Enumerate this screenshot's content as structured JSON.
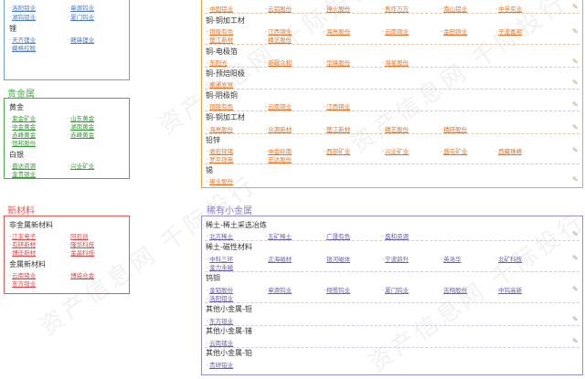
{
  "colors": {
    "blue": "#6f9fd8",
    "green": "#4cae4c",
    "red": "#e05a5a",
    "orange": "#f0a040",
    "purple": "#9a8fc4"
  },
  "watermark": "资产信息网 千际投行",
  "top_left": {
    "row1": [
      "洛阳钼业",
      "章源钨业"
    ],
    "row2": [
      "湖钨钼业",
      "厦门钨业"
    ],
    "cat": "锂",
    "row3": [
      "天齐锂业",
      "赣锋锂业"
    ],
    "row4": [
      "藏格控股"
    ]
  },
  "precious": {
    "title": "贵金属",
    "cat1": "黄金",
    "gold": [
      [
        "紫金矿业",
        "山东黄金"
      ],
      [
        "中金黄金",
        "湖南黄金"
      ],
      [
        "赤峰黄金",
        "赤峰黄金"
      ],
      [
        "恒邦股份",
        ""
      ]
    ],
    "cat2": "白银",
    "silver": [
      [
        "盛达资源",
        "兴业矿业"
      ],
      [
        "金贵银业",
        ""
      ]
    ]
  },
  "newmat": {
    "title": "新材料",
    "cat1": "非金属新材料",
    "nm1": [
      [
        "江丰电子",
        "阿石创"
      ],
      [
        "有研新材",
        "隆华科技"
      ],
      [
        "博迁新材",
        "金晶科技"
      ]
    ],
    "cat2": "金属新材料",
    "nm2": [
      [
        "云南锗业",
        "博威合金"
      ],
      [
        "东方钽业",
        ""
      ]
    ]
  },
  "copper": {
    "row0": [
      "中国铝业",
      "云铝股份",
      "神火股份",
      "焦作万方",
      "南山铝业",
      "中孚实业"
    ],
    "cat1": "铜-铜加工材",
    "r1": [
      "铜陵有色",
      "江西铜业",
      "海亮股份",
      "云南铜业",
      "金田铜业",
      "宁波富邦"
    ],
    "r1b": [
      "楚江新材",
      "精艺股份"
    ],
    "cat2": "铜-电极箔",
    "r2": [
      "东阳光",
      "新疆众和",
      "华锋股份",
      "海星股份"
    ],
    "cat3": "铜-预焙阳极",
    "r3": [
      "索通发展"
    ],
    "cat4": "铜-阴极铜",
    "r4": [
      "铜陵有色",
      "云南铜业",
      "江西铜业"
    ],
    "cat5": "铜-铜加工材",
    "r5": [
      "海亮股份",
      "众源新材",
      "楚江新材",
      "精艺股份",
      "精研股份"
    ],
    "cat6": "铅锌",
    "r6": [
      "驰宏锌锗",
      "中金岭南",
      "西部矿业",
      "兴业矿业",
      "盛屯矿业",
      "西藏珠峰"
    ],
    "r6b": [
      "罗平锌电",
      "宏达股份"
    ],
    "cat7": "锡",
    "r7": [
      "锡业股份"
    ]
  },
  "rare": {
    "title": "稀有小金属",
    "cat1": "稀土-稀土采选冶炼",
    "r1": [
      "北方稀土",
      "五矿稀土",
      "广晟有色",
      "盛和资源"
    ],
    "cat2": "稀土-磁性材料",
    "r2": [
      "中科三环",
      "正海磁材",
      "银河磁体",
      "宁波韵升",
      "英洛华",
      "北矿科技"
    ],
    "r2b": [
      "金力永磁"
    ],
    "cat3": "钨钼",
    "r3": [
      "金钼股份",
      "章源钨业",
      "翔鹭钨业",
      "厦门钨业",
      "吉翔股份",
      "中钨高新"
    ],
    "r3b": [
      "洛阳钼业"
    ],
    "cat4": "其他小金属-钽",
    "r4": [
      "东方钽业"
    ],
    "cat5": "其他小金属-锗",
    "r5": [
      "云南锗业"
    ],
    "cat6": "其他小金属-铂",
    "r6": [
      "贵研铂业"
    ]
  }
}
